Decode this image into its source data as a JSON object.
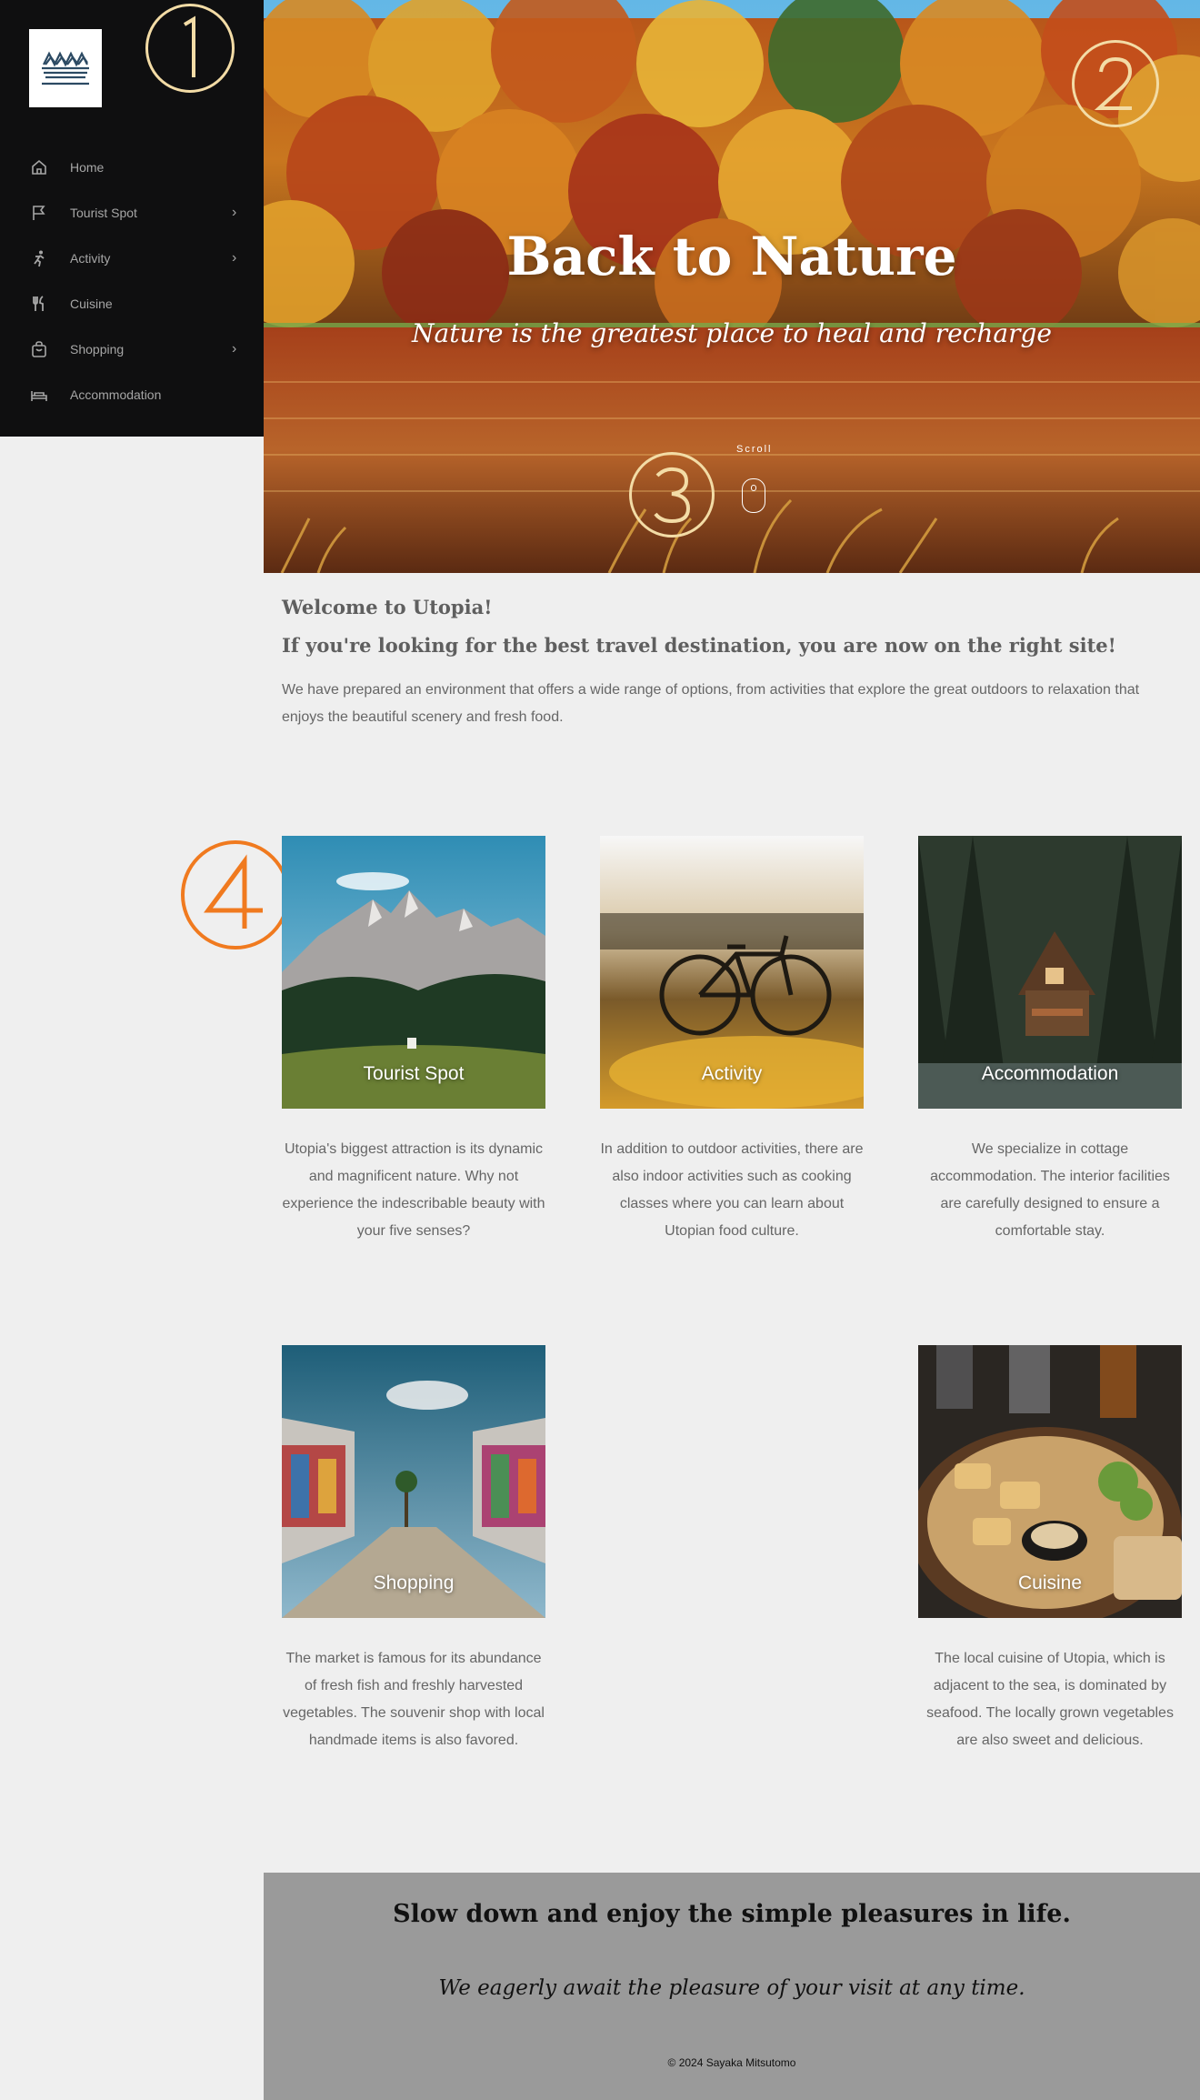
{
  "sidebar": {
    "logo_icon": "mountain-lake-logo",
    "items": [
      {
        "label": "Home",
        "icon": "home-icon",
        "has_submenu": false
      },
      {
        "label": "Tourist Spot",
        "icon": "flag-icon",
        "has_submenu": true
      },
      {
        "label": "Activity",
        "icon": "running-icon",
        "has_submenu": true
      },
      {
        "label": "Cuisine",
        "icon": "utensils-icon",
        "has_submenu": false
      },
      {
        "label": "Shopping",
        "icon": "shopping-bag-icon",
        "has_submenu": true
      },
      {
        "label": "Accommodation",
        "icon": "bed-icon",
        "has_submenu": false
      }
    ]
  },
  "annotations": {
    "n1": "①",
    "n2": "②",
    "n3": "③",
    "n4": "④",
    "color_cream": "#f3dca6",
    "color_orange": "#f07a1f"
  },
  "hero": {
    "title": "Back to Nature",
    "subtitle": "Nature is the greatest place to heal and recharge",
    "scroll_label": "Scroll"
  },
  "intro": {
    "heading1": "Welcome to Utopia!",
    "heading2": "If you're looking for the best travel destination, you are now on the right site!",
    "body": "We have prepared an environment that offers a wide range of options, from activities that explore the great outdoors to relaxation that enjoys the beautiful scenery and fresh food."
  },
  "cards": [
    {
      "label": "Tourist Spot",
      "desc": "Utopia's biggest attraction is its dynamic and magnificent nature. Why not experience the indescribable beauty with your five senses?"
    },
    {
      "label": "Activity",
      "desc": "In addition to outdoor activities, there are also indoor activities such as cooking classes where you can learn about Utopian food culture."
    },
    {
      "label": "Accommodation",
      "desc": "We specialize in cottage accommodation. The interior facilities are carefully designed to ensure a comfortable stay."
    },
    {
      "label": "Shopping",
      "desc": "The market is famous for its abundance of fresh fish and freshly harvested vegetables. The souvenir shop with local handmade items is also favored."
    },
    {
      "label": "Cuisine",
      "desc": "The local cuisine of Utopia, which is adjacent to the sea, is dominated by seafood. The locally grown vegetables are also sweet and delicious."
    }
  ],
  "footer": {
    "tagline": "Slow down and enjoy the simple pleasures in life.",
    "subline": "We eagerly await the pleasure of your visit at any time.",
    "copyright": "© 2024 Sayaka Mitsutomo"
  }
}
